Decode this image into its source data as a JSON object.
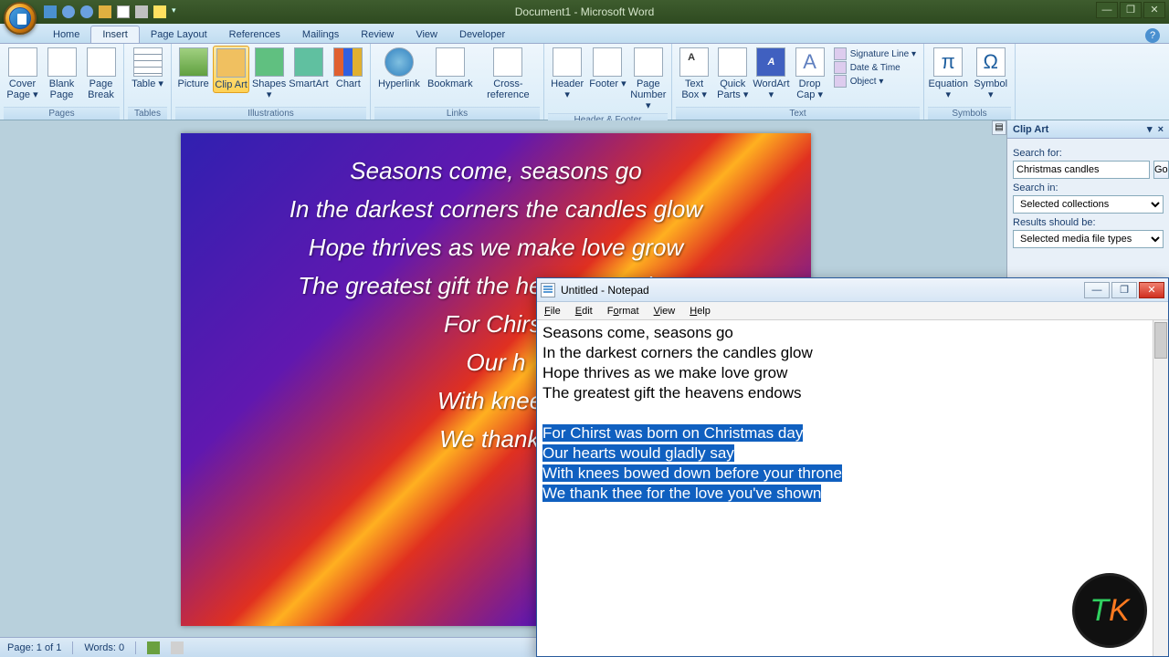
{
  "word": {
    "title": "Document1 - Microsoft Word",
    "qat_icons": [
      "save",
      "undo",
      "redo",
      "open",
      "new",
      "print",
      "highlight"
    ],
    "tabs": [
      "Home",
      "Insert",
      "Page Layout",
      "References",
      "Mailings",
      "Review",
      "View",
      "Developer"
    ],
    "active_tab": "Insert",
    "ribbon_groups": {
      "pages": {
        "label": "Pages",
        "buttons": [
          "Cover Page ▾",
          "Blank Page",
          "Page Break"
        ]
      },
      "tables": {
        "label": "Tables",
        "buttons": [
          "Table ▾"
        ]
      },
      "illustrations": {
        "label": "Illustrations",
        "buttons": [
          "Picture",
          "Clip Art",
          "Shapes ▾",
          "SmartArt",
          "Chart"
        ],
        "selected": "Clip Art"
      },
      "links": {
        "label": "Links",
        "buttons": [
          "Hyperlink",
          "Bookmark",
          "Cross-reference"
        ]
      },
      "header_footer": {
        "label": "Header & Footer",
        "buttons": [
          "Header ▾",
          "Footer ▾",
          "Page Number ▾"
        ]
      },
      "text": {
        "label": "Text",
        "buttons": [
          "Text Box ▾",
          "Quick Parts ▾",
          "WordArt ▾",
          "Drop Cap ▾"
        ],
        "side": [
          "Signature Line ▾",
          "Date & Time",
          "Object ▾"
        ]
      },
      "symbols": {
        "label": "Symbols",
        "buttons": [
          "Equation ▾",
          "Symbol ▾"
        ]
      }
    },
    "status": {
      "page": "Page: 1 of 1",
      "words": "Words: 0"
    }
  },
  "document_lines": [
    "Seasons come, seasons go",
    "In the darkest corners the candles glow",
    "Hope thrives as we make love grow",
    "The greatest gift the heavens endows",
    "For Chirst",
    "Our h",
    "With knees",
    "We thank t"
  ],
  "clipart": {
    "title": "Clip Art",
    "search_label": "Search for:",
    "search_value": "Christmas candles",
    "go": "Go",
    "searchin_label": "Search in:",
    "searchin_value": "Selected collections",
    "results_label": "Results should be:",
    "results_value": "Selected media file types"
  },
  "notepad": {
    "title": "Untitled - Notepad",
    "menus": [
      "File",
      "Edit",
      "Format",
      "View",
      "Help"
    ],
    "plain_lines": [
      "Seasons come, seasons go",
      "In the darkest corners the candles glow",
      "Hope thrives as we make love grow",
      "The greatest gift the heavens endows",
      ""
    ],
    "selected_lines": [
      "For Chirst was born on Christmas day",
      "Our hearts would gladly say",
      "With knees bowed down before your throne",
      "We thank thee for the love you've shown"
    ]
  },
  "icons": {
    "min": "—",
    "max": "❐",
    "close": "✕",
    "dropdown": "▾"
  }
}
